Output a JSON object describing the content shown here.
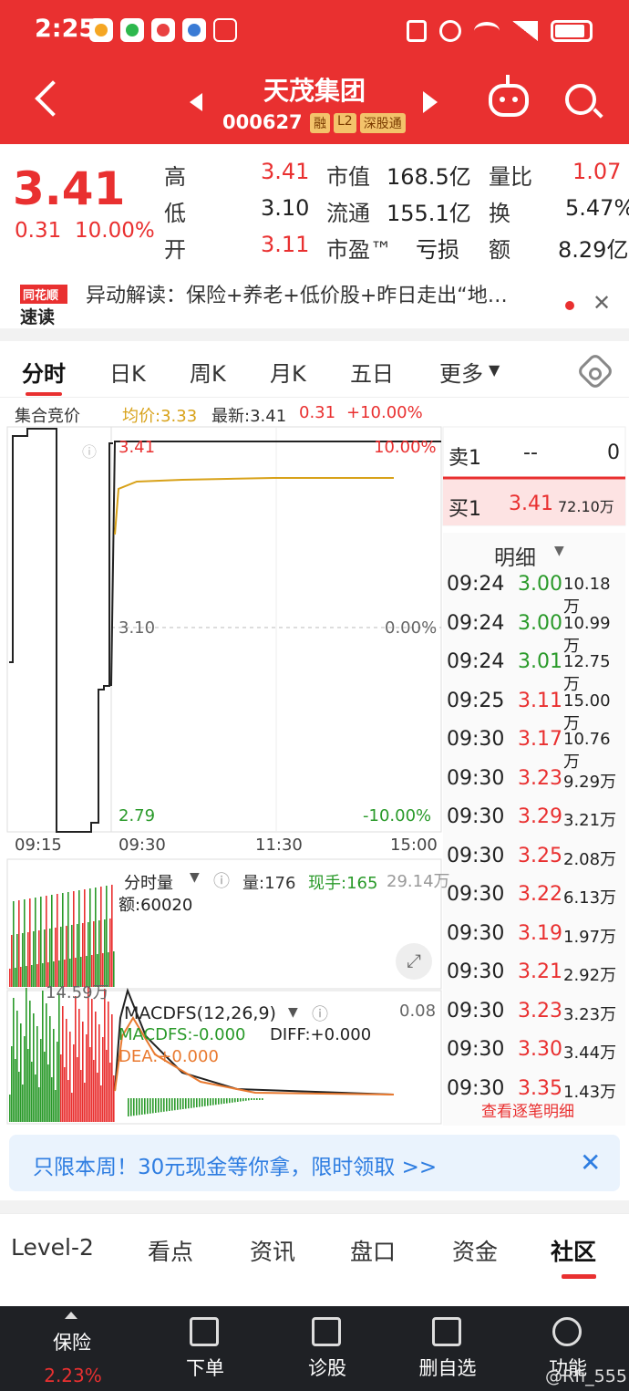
{
  "status_bar": {
    "time": "2:25"
  },
  "header": {
    "stock_name": "天茂集团",
    "stock_code": "000627",
    "badges": [
      "融",
      "L2",
      "深股通"
    ]
  },
  "quote": {
    "price": "3.41",
    "change": "0.31",
    "change_pct": "10.00%",
    "rows": [
      {
        "l1": "高",
        "v1": "3.41",
        "l2": "市值",
        "v2": "168.5亿",
        "l3": "量比",
        "v3": "1.07"
      },
      {
        "l1": "低",
        "v1": "3.10",
        "l2": "流通",
        "v2": "155.1亿",
        "l3": "换",
        "v3": "5.47%"
      },
      {
        "l1": "开",
        "v1": "3.11",
        "l2": "市盈™",
        "v2": "亏损",
        "l3": "额",
        "v3": "8.29亿"
      }
    ]
  },
  "anomaly": {
    "logo_top": "同花顺",
    "logo_bottom": "速读",
    "text": "异动解读：保险+养老+低价股+昨日走出“地…"
  },
  "chart_tabs": [
    "分时",
    "日K",
    "周K",
    "月K",
    "五日",
    "更多"
  ],
  "chart_info": {
    "auction_label": "集合竞价",
    "avg_label": "均价:3.33",
    "latest_label": "最新:3.41",
    "chg": "0.31",
    "pct": "+10.00%"
  },
  "chart_labels": {
    "top_price": "3.41",
    "top_pct": "10.00%",
    "mid_price": "3.10",
    "mid_pct": "0.00%",
    "bot_price": "2.79",
    "bot_pct": "-10.00%",
    "t0": "09:15",
    "t1": "09:30",
    "t2": "11:30",
    "t3": "15:00"
  },
  "volume_panel": {
    "title": "分时量",
    "vol": "量:176",
    "hand": "现手:165",
    "max": "29.14万",
    "amount": "额:60020",
    "side_val": "14.59万"
  },
  "macd_panel": {
    "title": "MACDFS(12,26,9)",
    "macdfs": "MACDFS:-0.000",
    "diff": "DIFF:+0.000",
    "dea": "DEA:+0.000",
    "max": "0.08"
  },
  "order_book": {
    "sell1_label": "卖1",
    "sell1_price": "--",
    "sell1_vol": "0",
    "buy1_label": "买1",
    "buy1_price": "3.41",
    "buy1_vol": "72.10万"
  },
  "detail": {
    "title": "明细",
    "rows": [
      {
        "time": "09:24",
        "price": "3.00",
        "vol": "10.18万",
        "dir": "down"
      },
      {
        "time": "09:24",
        "price": "3.00",
        "vol": "10.99万",
        "dir": "down"
      },
      {
        "time": "09:24",
        "price": "3.01",
        "vol": "12.75万",
        "dir": "down"
      },
      {
        "time": "09:25",
        "price": "3.11",
        "vol": "15.00万",
        "dir": "up"
      },
      {
        "time": "09:30",
        "price": "3.17",
        "vol": "10.76万",
        "dir": "up"
      },
      {
        "time": "09:30",
        "price": "3.23",
        "vol": "9.29万",
        "dir": "up"
      },
      {
        "time": "09:30",
        "price": "3.29",
        "vol": "3.21万",
        "dir": "up"
      },
      {
        "time": "09:30",
        "price": "3.25",
        "vol": "2.08万",
        "dir": "up"
      },
      {
        "time": "09:30",
        "price": "3.22",
        "vol": "6.13万",
        "dir": "up"
      },
      {
        "time": "09:30",
        "price": "3.19",
        "vol": "1.97万",
        "dir": "up"
      },
      {
        "time": "09:30",
        "price": "3.21",
        "vol": "2.92万",
        "dir": "up"
      },
      {
        "time": "09:30",
        "price": "3.23",
        "vol": "3.23万",
        "dir": "up"
      },
      {
        "time": "09:30",
        "price": "3.30",
        "vol": "3.44万",
        "dir": "up"
      },
      {
        "time": "09:30",
        "price": "3.35",
        "vol": "1.43万",
        "dir": "up"
      }
    ],
    "more": "查看逐笔明细"
  },
  "promo": {
    "text": "只限本周！30元现金等你拿，限时领取 >>"
  },
  "info_tabs": [
    "Level-2",
    "看点",
    "资讯",
    "盘口",
    "资金",
    "社区"
  ],
  "bottom_nav": {
    "items": [
      "保险",
      "下单",
      "诊股",
      "删自选",
      "功能"
    ],
    "insurance_pct": "2.23%"
  },
  "watermark": "@Rfi_555",
  "colors": {
    "brand_red": "#e93030",
    "up": "#e93030",
    "down": "#2a9a2a",
    "avg_line": "#d8a21a"
  }
}
